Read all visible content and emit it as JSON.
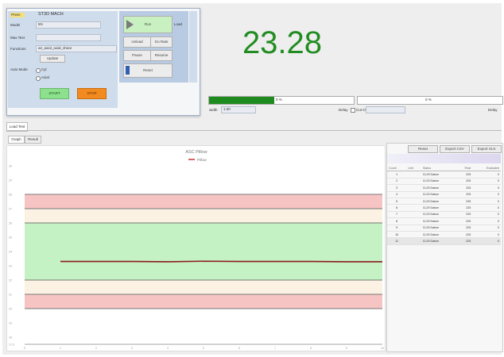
{
  "control_panel": {
    "title": "ST3D MACH",
    "tag": "Press",
    "fields": [
      {
        "label": "Model",
        "value": "5N"
      },
      {
        "label": "Max Test",
        "value": ""
      },
      {
        "label": "Functions",
        "value": "a2_axial_axial_shear"
      }
    ],
    "small_button": "Update",
    "radio_label": "Auto Mode",
    "radio_options": [
      "Cyl",
      "Axial"
    ],
    "start_label": "START",
    "stop_label": "STOP",
    "side_buttons": {
      "play": "Run",
      "b1": "Unload",
      "b2": "Go Rate",
      "b3": "Pause",
      "b4": "Resume",
      "reset": "Reset"
    },
    "side_label": "Load"
  },
  "readout": {
    "value": "23.28"
  },
  "progress": {
    "left_text": "0 %",
    "left_fraction": 0.45,
    "right_text": "0 %",
    "width_label": "width",
    "width_value": "1.00",
    "delay1": "Delay",
    "delay2": "Delay",
    "checkbox_label": "Cut Off"
  },
  "tabs": {
    "main": "Load Test",
    "sub1": "Graph",
    "sub2": "Result"
  },
  "table_buttons": [
    "Reset",
    "Export CSV",
    "Export XLS"
  ],
  "table_header": [
    "Count",
    "Unit",
    "Status",
    "Final",
    "Evaluated"
  ],
  "table_rows": [
    [
      "1",
      "",
      "CL29 Datum",
      "225",
      "0"
    ],
    [
      "2",
      "",
      "CL29 Datum",
      "225",
      "0"
    ],
    [
      "3",
      "",
      "CL29 Datum",
      "225",
      "0"
    ],
    [
      "4",
      "",
      "CL29 Datum",
      "225",
      "0"
    ],
    [
      "5",
      "",
      "CL29 Datum",
      "225",
      "0"
    ],
    [
      "6",
      "",
      "CL29 Datum",
      "225",
      "0"
    ],
    [
      "7",
      "",
      "CL29 Datum",
      "225",
      "0"
    ],
    [
      "8",
      "",
      "CL29 Datum",
      "225",
      "0"
    ],
    [
      "9",
      "",
      "CL29 Datum",
      "225",
      "0"
    ],
    [
      "10",
      "",
      "CL29 Datum",
      "225",
      "0"
    ],
    [
      "11",
      "",
      "CL29 Datum",
      "225",
      "0"
    ]
  ],
  "chart_data": {
    "type": "line",
    "title": "ASC Pillow",
    "series": [
      {
        "name": "Pillow",
        "color": "#8b1a1a",
        "x": [
          1,
          2,
          3,
          4,
          5,
          6,
          7,
          8,
          9,
          10
        ],
        "y": [
          23.3,
          23.3,
          23.3,
          23.28,
          23.32,
          23.3,
          23.3,
          23.3,
          23.28,
          23.28
        ]
      }
    ],
    "bands": [
      {
        "from": 27.0,
        "to": 28.0,
        "color": "#f7c4c4"
      },
      {
        "from": 26.0,
        "to": 27.0,
        "color": "#fbf2e3"
      },
      {
        "from": 22.0,
        "to": 26.0,
        "color": "#c4f2c4"
      },
      {
        "from": 21.0,
        "to": 22.0,
        "color": "#fbf2e3"
      },
      {
        "from": 20.0,
        "to": 21.0,
        "color": "#f7c4c4"
      }
    ],
    "ylim": [
      17.5,
      30
    ],
    "xlim": [
      0,
      10
    ],
    "yticks": [
      "17.5",
      "18",
      "19",
      "20",
      "21",
      "22",
      "23",
      "24",
      "25",
      "26",
      "27",
      "28",
      "29",
      "30"
    ],
    "xticks": [
      "0",
      "1",
      "2",
      "3",
      "4",
      "5",
      "6",
      "7",
      "8",
      "9",
      "10"
    ]
  }
}
